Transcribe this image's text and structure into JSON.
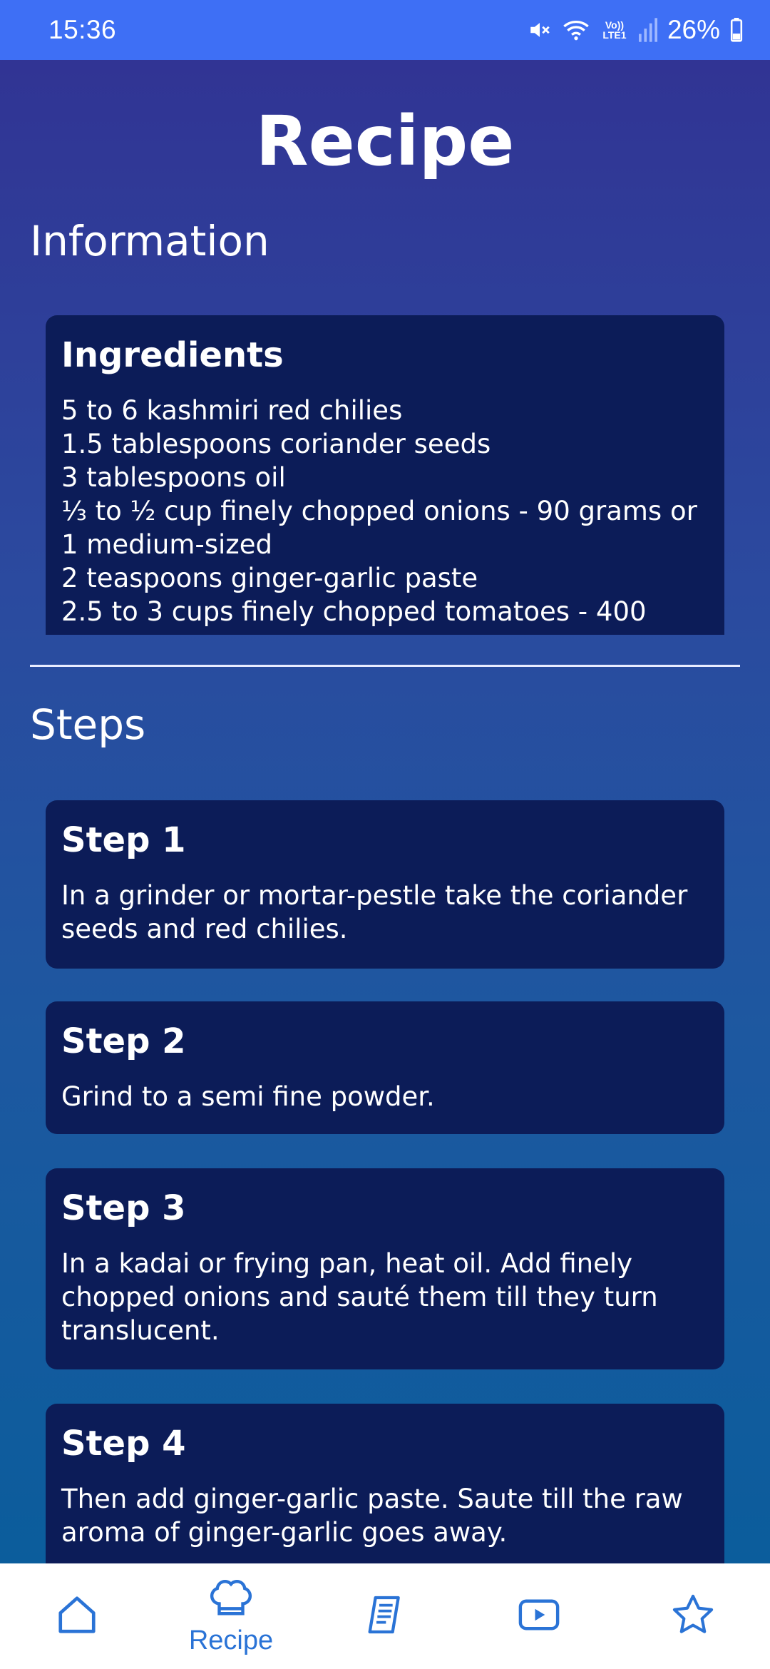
{
  "status_bar": {
    "time": "15:36",
    "battery": "26%",
    "network_label": "Vo)) LTE1"
  },
  "page": {
    "title": "Recipe"
  },
  "information": {
    "heading": "Information",
    "ingredients_card": {
      "title": "Ingredients",
      "items": [
        "5 to 6 kashmiri red chilies",
        "1.5 tablespoons coriander seeds",
        "3 tablespoons oil",
        "⅓ to ½ cup finely chopped onions - 90 grams or 1 medium-sized",
        "2 teaspoons ginger-garlic paste",
        "2.5 to 3 cups finely chopped tomatoes - 400"
      ]
    }
  },
  "steps": {
    "heading": "Steps",
    "items": [
      {
        "title": "Step 1",
        "text": "In a grinder or mortar-pestle take the coriander seeds and red chilies."
      },
      {
        "title": "Step 2",
        "text": "Grind to a semi fine powder."
      },
      {
        "title": "Step 3",
        "text": "In a kadai or frying pan, heat oil. Add finely chopped onions and sauté them till they turn translucent."
      },
      {
        "title": "Step 4",
        "text": "Then add ginger-garlic paste. Saute till the raw aroma of ginger-garlic goes away."
      }
    ]
  },
  "bottom_nav": {
    "active_label": "Recipe",
    "items": [
      {
        "icon": "home-icon"
      },
      {
        "icon": "chef-hat-icon",
        "label": "Recipe"
      },
      {
        "icon": "recipe-list-icon"
      },
      {
        "icon": "video-play-icon"
      },
      {
        "icon": "star-icon"
      }
    ]
  },
  "colors": {
    "status_bar": "#3e6ff5",
    "card_bg": "#0c1c58",
    "nav_accent": "#2a73d6"
  }
}
